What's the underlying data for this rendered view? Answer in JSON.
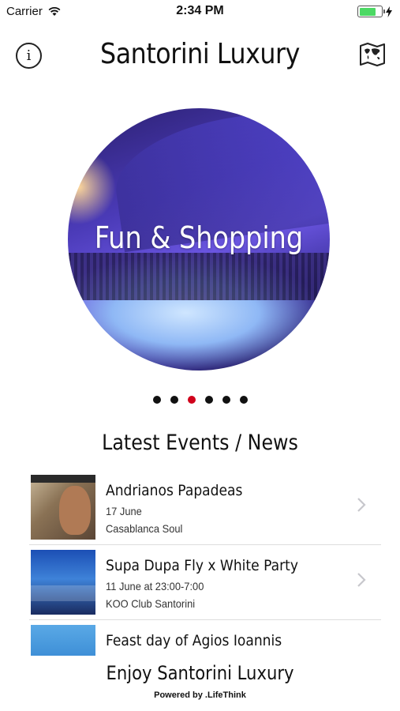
{
  "status_bar": {
    "carrier": "Carrier",
    "time": "2:34 PM",
    "battery_level": 0.75,
    "battery_color": "#4cd964"
  },
  "nav": {
    "title": "Santorini Luxury",
    "left_icon": "info-icon",
    "left_glyph": "i",
    "right_icon": "world-map-icon"
  },
  "carousel": {
    "label": "Fun & Shopping",
    "page_count": 6,
    "active_index": 2,
    "active_dot_color": "#d0021b"
  },
  "section": {
    "title": "Latest Events / News"
  },
  "events": [
    {
      "title": "Andrianos Papadeas",
      "date": "17 June",
      "venue": "Casablanca Soul"
    },
    {
      "title": "Supa Dupa Fly x White Party",
      "date": "11 June at 23:00-7:00",
      "venue": "KOO Club Santorini"
    },
    {
      "title": "Feast day of Agios Ioannis",
      "date": "",
      "venue": ""
    }
  ],
  "footer": {
    "title": "Enjoy Santorini Luxury",
    "credit": "Powered by .LifeThink"
  }
}
